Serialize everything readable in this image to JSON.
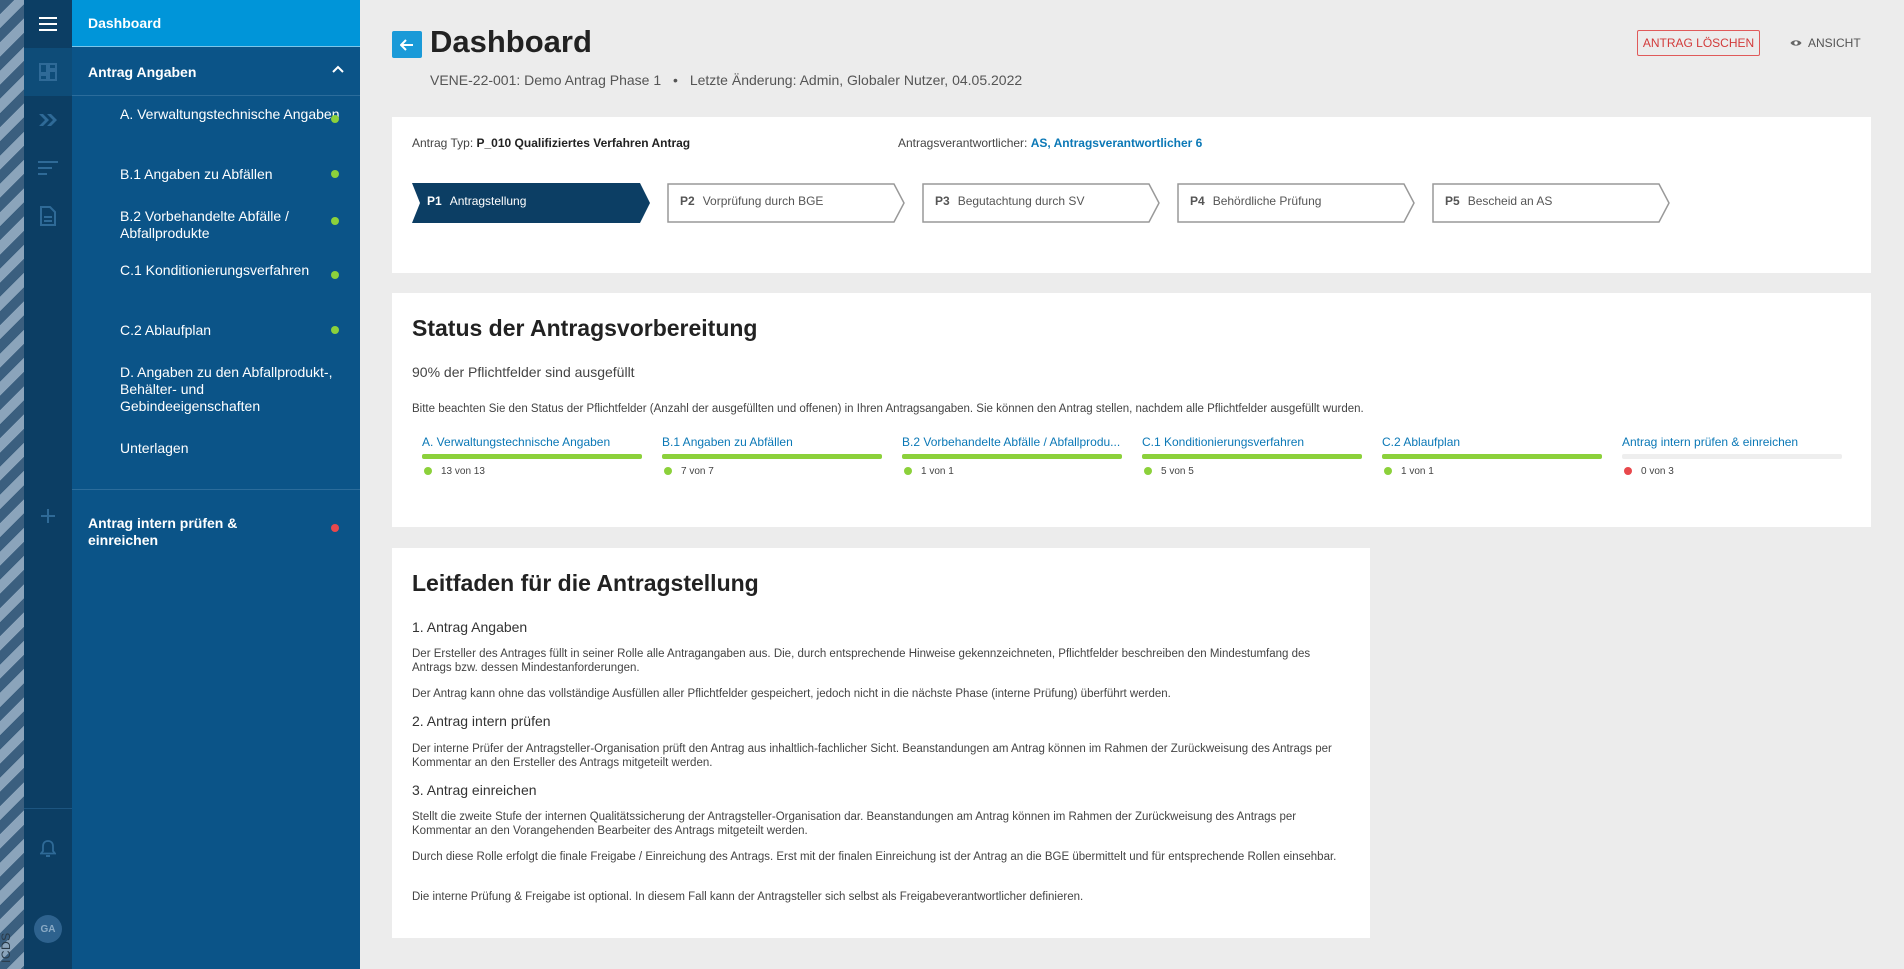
{
  "brand": "ICDS",
  "colors": {
    "accent": "#0095d9",
    "nav_bg": "#0b5488",
    "rail_bg": "#0c3e64",
    "green": "#8cd13b",
    "red": "#e8484c",
    "link": "#0b78b6"
  },
  "rail": {
    "icons": [
      "menu-icon",
      "dashboard-grid-icon",
      "double-chevron-icon",
      "filter-list-icon",
      "document-icon",
      "plus-icon",
      "bell-icon"
    ],
    "avatar": "GA"
  },
  "nav": {
    "dashboard": "Dashboard",
    "section": "Antrag Angaben",
    "items": [
      {
        "label": "A. Verwaltungstechnische Angaben",
        "status": "green"
      },
      {
        "label": "B.1 Angaben zu Abfällen",
        "status": "green"
      },
      {
        "label": "B.2 Vorbehandelte Abfälle / Abfallprodukte",
        "status": "green"
      },
      {
        "label": "C.1 Konditionierungsverfahren",
        "status": "green"
      },
      {
        "label": "C.2 Ablaufplan",
        "status": "green"
      },
      {
        "label": "D. Angaben zu den Abfallprodukt-, Behälter- und Gebindeeigenschaften",
        "status": ""
      },
      {
        "label": "Unterlagen",
        "status": ""
      }
    ],
    "submit": {
      "label": "Antrag intern prüfen & einreichen",
      "status": "red"
    }
  },
  "header": {
    "title": "Dashboard",
    "subtitle": "VENE-22-001: Demo Antrag Phase 1",
    "bullet": "•",
    "last_change": "Letzte Änderung: Admin, Globaler Nutzer, 04.05.2022",
    "delete_label": "ANTRAG LÖSCHEN",
    "view_label": "ANSICHT"
  },
  "overview": {
    "type_label": "Antrag Typ:",
    "type_value": "P_010 Qualifiziertes Verfahren Antrag",
    "resp_label": "Antragsverantwortlicher:",
    "resp_value": "AS, Antragsverantwortlicher 6",
    "phases": [
      {
        "code": "P1",
        "label": "Antragstellung",
        "active": true
      },
      {
        "code": "P2",
        "label": "Vorprüfung durch BGE",
        "active": false
      },
      {
        "code": "P3",
        "label": "Begutachtung durch SV",
        "active": false
      },
      {
        "code": "P4",
        "label": "Behördliche Prüfung",
        "active": false
      },
      {
        "code": "P5",
        "label": "Bescheid an AS",
        "active": false
      }
    ]
  },
  "status": {
    "title": "Status der Antragsvorbereitung",
    "percent_text": "90% der Pflichtfelder sind ausgefüllt",
    "note": "Bitte beachten Sie den Status der Pflichtfelder (Anzahl der ausgefüllten und offenen) in Ihren Antragsangaben. Sie können den Antrag stellen, nachdem alle Pflichtfelder ausgefüllt wurden.",
    "items": [
      {
        "label": "A. Verwaltungstechnische Angaben",
        "count": "13 von 13",
        "fraction": 1.0,
        "status": "green"
      },
      {
        "label": "B.1 Angaben zu Abfällen",
        "count": "7 von 7",
        "fraction": 1.0,
        "status": "green"
      },
      {
        "label": "B.2 Vorbehandelte Abfälle / Abfallprodu...",
        "count": "1 von 1",
        "fraction": 1.0,
        "status": "green"
      },
      {
        "label": "C.1 Konditionierungsverfahren",
        "count": "5 von 5",
        "fraction": 1.0,
        "status": "green"
      },
      {
        "label": "C.2 Ablaufplan",
        "count": "1 von 1",
        "fraction": 1.0,
        "status": "green"
      },
      {
        "label": "Antrag intern prüfen & einreichen",
        "count": "0 von 3",
        "fraction": 0.0,
        "status": "red"
      }
    ]
  },
  "guide": {
    "title": "Leitfaden für die Antragstellung",
    "h1": "1. Antrag Angaben",
    "p1": "Der Ersteller des Antrages füllt in seiner Rolle alle Antragangaben aus. Die, durch entsprechende Hinweise gekennzeichneten, Pflichtfelder beschreiben den Mindestumfang des Antrags bzw. dessen Mindestanforderungen.",
    "p2": "Der Antrag kann ohne das vollständige Ausfüllen aller Pflichtfelder gespeichert, jedoch nicht in die nächste Phase (interne Prüfung) überführt werden.",
    "h2": "2. Antrag intern prüfen",
    "p3": "Der interne Prüfer der Antragsteller-Organisation prüft den Antrag aus inhaltlich-fachlicher Sicht. Beanstandungen am Antrag können im Rahmen der Zurückweisung des Antrags per Kommentar an den Ersteller des Antrags mitgeteilt werden.",
    "h3": "3. Antrag einreichen",
    "p4": "Stellt die zweite Stufe der internen Qualitätssicherung der Antragsteller-Organisation dar. Beanstandungen am Antrag können im Rahmen der Zurückweisung des Antrags per Kommentar an den Vorangehenden Bearbeiter des Antrags mitgeteilt werden.",
    "p5": "Durch diese Rolle erfolgt die finale Freigabe / Einreichung des Antrags. Erst mit der finalen Einreichung ist der Antrag an die BGE übermittelt und für entsprechende Rollen einsehbar.",
    "p6": "Die interne Prüfung & Freigabe ist optional. In diesem Fall kann der Antragsteller sich selbst als Freigabeverantwortlicher definieren."
  }
}
